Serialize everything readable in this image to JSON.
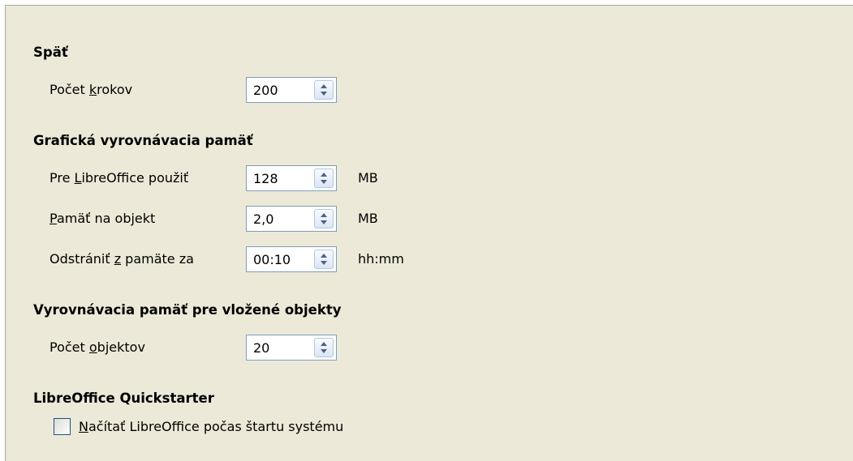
{
  "undo": {
    "title": "Späť",
    "steps": {
      "label_pre": "Počet ",
      "label_u": "k",
      "label_post": "rokov",
      "value": "200"
    }
  },
  "graphics_cache": {
    "title": "Grafická vyrovnávacia pamäť",
    "use_for": {
      "label_pre": "Pre ",
      "label_u": "L",
      "label_post": "ibreOffice použiť",
      "value": "128",
      "unit": "MB"
    },
    "per_object": {
      "label_pre": "",
      "label_u": "P",
      "label_post": "amäť na objekt",
      "value": "2,0",
      "unit": "MB"
    },
    "remove_after": {
      "label_pre": "Odstrániť ",
      "label_u": "z",
      "label_post": " pamäte za",
      "value": "00:10",
      "unit": "hh:mm"
    }
  },
  "embedded_cache": {
    "title": "Vyrovnávacia pamäť pre vložené objekty",
    "objects": {
      "label_pre": "Počet ",
      "label_u": "o",
      "label_post": "bjektov",
      "value": "20"
    }
  },
  "quickstarter": {
    "title": "LibreOffice Quickstarter",
    "load_label_u": "N",
    "load_label_post": "ačítať LibreOffice počas štartu systému",
    "checked": false
  }
}
